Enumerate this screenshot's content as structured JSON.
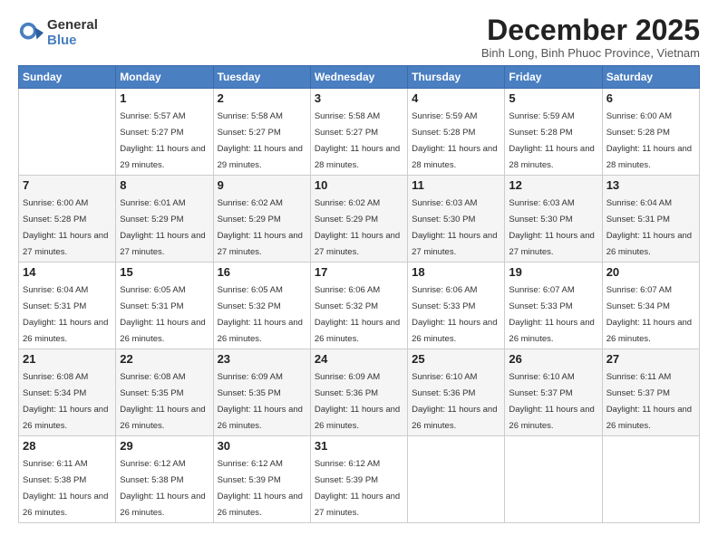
{
  "logo": {
    "general": "General",
    "blue": "Blue"
  },
  "title": "December 2025",
  "subtitle": "Binh Long, Binh Phuoc Province, Vietnam",
  "headers": [
    "Sunday",
    "Monday",
    "Tuesday",
    "Wednesday",
    "Thursday",
    "Friday",
    "Saturday"
  ],
  "weeks": [
    [
      {
        "num": "",
        "sunrise": "",
        "sunset": "",
        "daylight": ""
      },
      {
        "num": "1",
        "sunrise": "Sunrise: 5:57 AM",
        "sunset": "Sunset: 5:27 PM",
        "daylight": "Daylight: 11 hours and 29 minutes."
      },
      {
        "num": "2",
        "sunrise": "Sunrise: 5:58 AM",
        "sunset": "Sunset: 5:27 PM",
        "daylight": "Daylight: 11 hours and 29 minutes."
      },
      {
        "num": "3",
        "sunrise": "Sunrise: 5:58 AM",
        "sunset": "Sunset: 5:27 PM",
        "daylight": "Daylight: 11 hours and 28 minutes."
      },
      {
        "num": "4",
        "sunrise": "Sunrise: 5:59 AM",
        "sunset": "Sunset: 5:28 PM",
        "daylight": "Daylight: 11 hours and 28 minutes."
      },
      {
        "num": "5",
        "sunrise": "Sunrise: 5:59 AM",
        "sunset": "Sunset: 5:28 PM",
        "daylight": "Daylight: 11 hours and 28 minutes."
      },
      {
        "num": "6",
        "sunrise": "Sunrise: 6:00 AM",
        "sunset": "Sunset: 5:28 PM",
        "daylight": "Daylight: 11 hours and 28 minutes."
      }
    ],
    [
      {
        "num": "7",
        "sunrise": "Sunrise: 6:00 AM",
        "sunset": "Sunset: 5:28 PM",
        "daylight": "Daylight: 11 hours and 27 minutes."
      },
      {
        "num": "8",
        "sunrise": "Sunrise: 6:01 AM",
        "sunset": "Sunset: 5:29 PM",
        "daylight": "Daylight: 11 hours and 27 minutes."
      },
      {
        "num": "9",
        "sunrise": "Sunrise: 6:02 AM",
        "sunset": "Sunset: 5:29 PM",
        "daylight": "Daylight: 11 hours and 27 minutes."
      },
      {
        "num": "10",
        "sunrise": "Sunrise: 6:02 AM",
        "sunset": "Sunset: 5:29 PM",
        "daylight": "Daylight: 11 hours and 27 minutes."
      },
      {
        "num": "11",
        "sunrise": "Sunrise: 6:03 AM",
        "sunset": "Sunset: 5:30 PM",
        "daylight": "Daylight: 11 hours and 27 minutes."
      },
      {
        "num": "12",
        "sunrise": "Sunrise: 6:03 AM",
        "sunset": "Sunset: 5:30 PM",
        "daylight": "Daylight: 11 hours and 27 minutes."
      },
      {
        "num": "13",
        "sunrise": "Sunrise: 6:04 AM",
        "sunset": "Sunset: 5:31 PM",
        "daylight": "Daylight: 11 hours and 26 minutes."
      }
    ],
    [
      {
        "num": "14",
        "sunrise": "Sunrise: 6:04 AM",
        "sunset": "Sunset: 5:31 PM",
        "daylight": "Daylight: 11 hours and 26 minutes."
      },
      {
        "num": "15",
        "sunrise": "Sunrise: 6:05 AM",
        "sunset": "Sunset: 5:31 PM",
        "daylight": "Daylight: 11 hours and 26 minutes."
      },
      {
        "num": "16",
        "sunrise": "Sunrise: 6:05 AM",
        "sunset": "Sunset: 5:32 PM",
        "daylight": "Daylight: 11 hours and 26 minutes."
      },
      {
        "num": "17",
        "sunrise": "Sunrise: 6:06 AM",
        "sunset": "Sunset: 5:32 PM",
        "daylight": "Daylight: 11 hours and 26 minutes."
      },
      {
        "num": "18",
        "sunrise": "Sunrise: 6:06 AM",
        "sunset": "Sunset: 5:33 PM",
        "daylight": "Daylight: 11 hours and 26 minutes."
      },
      {
        "num": "19",
        "sunrise": "Sunrise: 6:07 AM",
        "sunset": "Sunset: 5:33 PM",
        "daylight": "Daylight: 11 hours and 26 minutes."
      },
      {
        "num": "20",
        "sunrise": "Sunrise: 6:07 AM",
        "sunset": "Sunset: 5:34 PM",
        "daylight": "Daylight: 11 hours and 26 minutes."
      }
    ],
    [
      {
        "num": "21",
        "sunrise": "Sunrise: 6:08 AM",
        "sunset": "Sunset: 5:34 PM",
        "daylight": "Daylight: 11 hours and 26 minutes."
      },
      {
        "num": "22",
        "sunrise": "Sunrise: 6:08 AM",
        "sunset": "Sunset: 5:35 PM",
        "daylight": "Daylight: 11 hours and 26 minutes."
      },
      {
        "num": "23",
        "sunrise": "Sunrise: 6:09 AM",
        "sunset": "Sunset: 5:35 PM",
        "daylight": "Daylight: 11 hours and 26 minutes."
      },
      {
        "num": "24",
        "sunrise": "Sunrise: 6:09 AM",
        "sunset": "Sunset: 5:36 PM",
        "daylight": "Daylight: 11 hours and 26 minutes."
      },
      {
        "num": "25",
        "sunrise": "Sunrise: 6:10 AM",
        "sunset": "Sunset: 5:36 PM",
        "daylight": "Daylight: 11 hours and 26 minutes."
      },
      {
        "num": "26",
        "sunrise": "Sunrise: 6:10 AM",
        "sunset": "Sunset: 5:37 PM",
        "daylight": "Daylight: 11 hours and 26 minutes."
      },
      {
        "num": "27",
        "sunrise": "Sunrise: 6:11 AM",
        "sunset": "Sunset: 5:37 PM",
        "daylight": "Daylight: 11 hours and 26 minutes."
      }
    ],
    [
      {
        "num": "28",
        "sunrise": "Sunrise: 6:11 AM",
        "sunset": "Sunset: 5:38 PM",
        "daylight": "Daylight: 11 hours and 26 minutes."
      },
      {
        "num": "29",
        "sunrise": "Sunrise: 6:12 AM",
        "sunset": "Sunset: 5:38 PM",
        "daylight": "Daylight: 11 hours and 26 minutes."
      },
      {
        "num": "30",
        "sunrise": "Sunrise: 6:12 AM",
        "sunset": "Sunset: 5:39 PM",
        "daylight": "Daylight: 11 hours and 26 minutes."
      },
      {
        "num": "31",
        "sunrise": "Sunrise: 6:12 AM",
        "sunset": "Sunset: 5:39 PM",
        "daylight": "Daylight: 11 hours and 27 minutes."
      },
      {
        "num": "",
        "sunrise": "",
        "sunset": "",
        "daylight": ""
      },
      {
        "num": "",
        "sunrise": "",
        "sunset": "",
        "daylight": ""
      },
      {
        "num": "",
        "sunrise": "",
        "sunset": "",
        "daylight": ""
      }
    ]
  ]
}
